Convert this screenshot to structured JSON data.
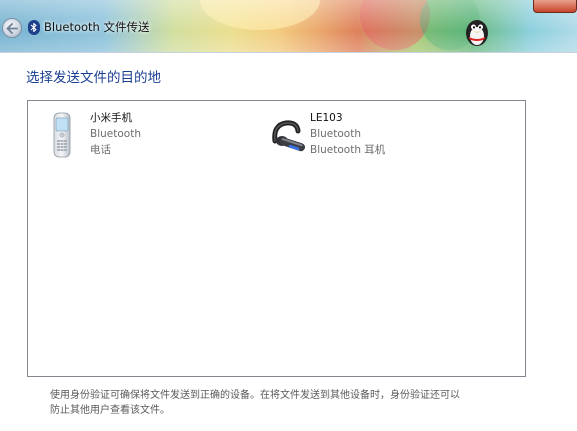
{
  "window": {
    "title": "Bluetooth 文件传送"
  },
  "main": {
    "heading": "选择发送文件的目的地",
    "devices": [
      {
        "name": "小米手机",
        "type": "Bluetooth",
        "category": "电话",
        "icon": "mobile-phone-icon"
      },
      {
        "name": "LE103",
        "type": "Bluetooth",
        "category": "Bluetooth 耳机",
        "icon": "bluetooth-headset-icon"
      }
    ],
    "footer_line1": "使用身份验证可确保将文件发送到正确的设备。在将文件发送到其他设备时，身份验证还可以",
    "footer_line2": "防止其他用户查看该文件。"
  },
  "colors": {
    "heading": "#1a3e92",
    "list_border": "#828790",
    "secondary_text": "#6d6d6d"
  }
}
